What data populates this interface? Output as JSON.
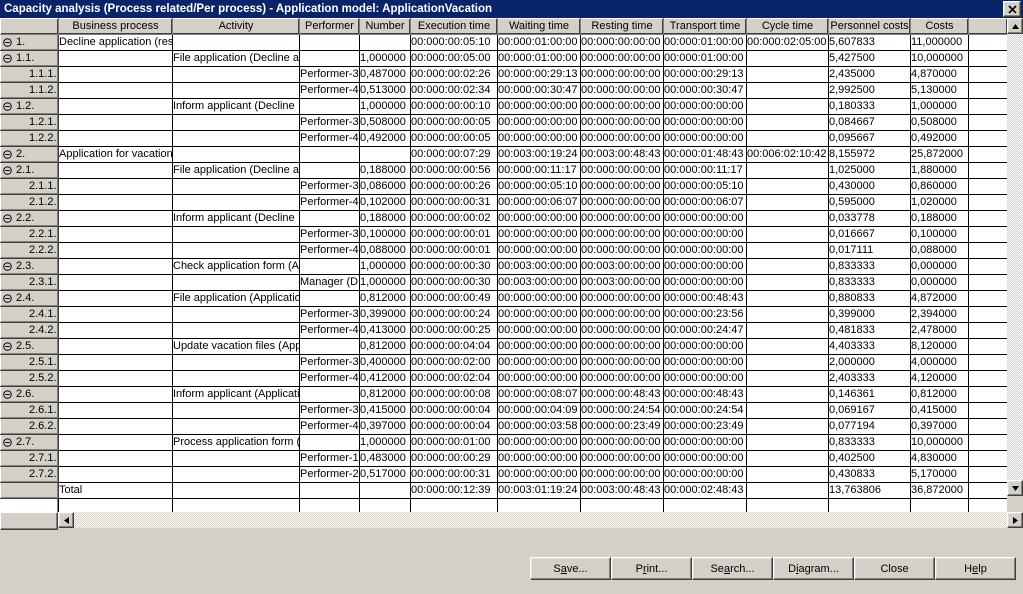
{
  "window": {
    "title": "Capacity analysis (Process related/Per process) - Application model: ApplicationVacation",
    "close_label": "✕"
  },
  "grid": {
    "columns": [
      {
        "key": "rowhdr",
        "label": ""
      },
      {
        "key": "business",
        "label": "Business process"
      },
      {
        "key": "activity",
        "label": "Activity"
      },
      {
        "key": "performer",
        "label": "Performer"
      },
      {
        "key": "number",
        "label": "Number"
      },
      {
        "key": "exec",
        "label": "Execution time"
      },
      {
        "key": "wait",
        "label": "Waiting time"
      },
      {
        "key": "rest",
        "label": "Resting time"
      },
      {
        "key": "transport",
        "label": "Transport time"
      },
      {
        "key": "cycle",
        "label": "Cycle time"
      },
      {
        "key": "personnel",
        "label": "Personnel costs"
      },
      {
        "key": "costs",
        "label": "Costs"
      },
      {
        "key": "pad",
        "label": ""
      }
    ],
    "rows": [
      {
        "num": "1.",
        "level": 0,
        "expander": "collapse",
        "business": "Decline application (res",
        "activity": "",
        "performer": "",
        "number": "",
        "exec": "00:000:00:05:10",
        "wait": "00:000:01:00:00",
        "rest": "00:000:00:00:00",
        "transport": "00:000:01:00:00",
        "cycle": "00:000:02:05:00",
        "personnel": "5,607833",
        "costs": "11,000000"
      },
      {
        "num": "1.1.",
        "level": 1,
        "expander": "collapse",
        "business": "",
        "activity": "File application (Decline a",
        "performer": "",
        "number": "1,000000",
        "exec": "00:000:00:05:00",
        "wait": "00:000:01:00:00",
        "rest": "00:000:00:00:00",
        "transport": "00:000:01:00:00",
        "cycle": "",
        "personnel": "5,427500",
        "costs": "10,000000"
      },
      {
        "num": "1.1.1.",
        "level": 2,
        "expander": "none",
        "business": "",
        "activity": "",
        "performer": "Performer-3",
        "number": "0,487000",
        "exec": "00:000:00:02:26",
        "wait": "00:000:00:29:13",
        "rest": "00:000:00:00:00",
        "transport": "00:000:00:29:13",
        "cycle": "",
        "personnel": "2,435000",
        "costs": "4,870000"
      },
      {
        "num": "1.1.2.",
        "level": 2,
        "expander": "none",
        "business": "",
        "activity": "",
        "performer": "Performer-4",
        "number": "0,513000",
        "exec": "00:000:00:02:34",
        "wait": "00:000:00:30:47",
        "rest": "00:000:00:00:00",
        "transport": "00:000:00:30:47",
        "cycle": "",
        "personnel": "2,992500",
        "costs": "5,130000"
      },
      {
        "num": "1.2.",
        "level": 1,
        "expander": "collapse",
        "business": "",
        "activity": "Inform applicant (Decline ",
        "performer": "",
        "number": "1,000000",
        "exec": "00:000:00:00:10",
        "wait": "00:000:00:00:00",
        "rest": "00:000:00:00:00",
        "transport": "00:000:00:00:00",
        "cycle": "",
        "personnel": "0,180333",
        "costs": "1,000000"
      },
      {
        "num": "1.2.1.",
        "level": 2,
        "expander": "none",
        "business": "",
        "activity": "",
        "performer": "Performer-3",
        "number": "0,508000",
        "exec": "00:000:00:00:05",
        "wait": "00:000:00:00:00",
        "rest": "00:000:00:00:00",
        "transport": "00:000:00:00:00",
        "cycle": "",
        "personnel": "0,084667",
        "costs": "0,508000"
      },
      {
        "num": "1.2.2.",
        "level": 2,
        "expander": "none",
        "business": "",
        "activity": "",
        "performer": "Performer-4",
        "number": "0,492000",
        "exec": "00:000:00:00:05",
        "wait": "00:000:00:00:00",
        "rest": "00:000:00:00:00",
        "transport": "00:000:00:00:00",
        "cycle": "",
        "personnel": "0,095667",
        "costs": "0,492000"
      },
      {
        "num": "2.",
        "level": 0,
        "expander": "collapse",
        "business": "Application for vacation",
        "activity": "",
        "performer": "",
        "number": "",
        "exec": "00:000:00:07:29",
        "wait": "00:003:00:19:24",
        "rest": "00:003:00:48:43",
        "transport": "00:000:01:48:43",
        "cycle": "00:006:02:10:42",
        "personnel": "8,155972",
        "costs": "25,872000"
      },
      {
        "num": "2.1.",
        "level": 1,
        "expander": "collapse",
        "business": "",
        "activity": "File application (Decline a",
        "performer": "",
        "number": "0,188000",
        "exec": "00:000:00:00:56",
        "wait": "00:000:00:11:17",
        "rest": "00:000:00:00:00",
        "transport": "00:000:00:11:17",
        "cycle": "",
        "personnel": "1,025000",
        "costs": "1,880000"
      },
      {
        "num": "2.1.1.",
        "level": 2,
        "expander": "none",
        "business": "",
        "activity": "",
        "performer": "Performer-3",
        "number": "0,086000",
        "exec": "00:000:00:00:26",
        "wait": "00:000:00:05:10",
        "rest": "00:000:00:00:00",
        "transport": "00:000:00:05:10",
        "cycle": "",
        "personnel": "0,430000",
        "costs": "0,860000"
      },
      {
        "num": "2.1.2.",
        "level": 2,
        "expander": "none",
        "business": "",
        "activity": "",
        "performer": "Performer-4",
        "number": "0,102000",
        "exec": "00:000:00:00:31",
        "wait": "00:000:00:06:07",
        "rest": "00:000:00:00:00",
        "transport": "00:000:00:06:07",
        "cycle": "",
        "personnel": "0,595000",
        "costs": "1,020000"
      },
      {
        "num": "2.2.",
        "level": 1,
        "expander": "collapse",
        "business": "",
        "activity": "Inform applicant (Decline ",
        "performer": "",
        "number": "0,188000",
        "exec": "00:000:00:00:02",
        "wait": "00:000:00:00:00",
        "rest": "00:000:00:00:00",
        "transport": "00:000:00:00:00",
        "cycle": "",
        "personnel": "0,033778",
        "costs": "0,188000"
      },
      {
        "num": "2.2.1.",
        "level": 2,
        "expander": "none",
        "business": "",
        "activity": "",
        "performer": "Performer-3",
        "number": "0,100000",
        "exec": "00:000:00:00:01",
        "wait": "00:000:00:00:00",
        "rest": "00:000:00:00:00",
        "transport": "00:000:00:00:00",
        "cycle": "",
        "personnel": "0,016667",
        "costs": "0,100000"
      },
      {
        "num": "2.2.2.",
        "level": 2,
        "expander": "none",
        "business": "",
        "activity": "",
        "performer": "Performer-4",
        "number": "0,088000",
        "exec": "00:000:00:00:01",
        "wait": "00:000:00:00:00",
        "rest": "00:000:00:00:00",
        "transport": "00:000:00:00:00",
        "cycle": "",
        "personnel": "0,017111",
        "costs": "0,088000"
      },
      {
        "num": "2.3.",
        "level": 1,
        "expander": "collapse",
        "business": "",
        "activity": "Check application form (A",
        "performer": "",
        "number": "1,000000",
        "exec": "00:000:00:00:30",
        "wait": "00:003:00:00:00",
        "rest": "00:003:00:00:00",
        "transport": "00:000:00:00:00",
        "cycle": "",
        "personnel": "0,833333",
        "costs": "0,000000"
      },
      {
        "num": "2.3.1.",
        "level": 2,
        "expander": "none",
        "business": "",
        "activity": "",
        "performer": "Manager (D",
        "number": "1,000000",
        "exec": "00:000:00:00:30",
        "wait": "00:003:00:00:00",
        "rest": "00:003:00:00:00",
        "transport": "00:000:00:00:00",
        "cycle": "",
        "personnel": "0,833333",
        "costs": "0,000000"
      },
      {
        "num": "2.4.",
        "level": 1,
        "expander": "collapse",
        "business": "",
        "activity": "File application (Applicatio",
        "performer": "",
        "number": "0,812000",
        "exec": "00:000:00:00:49",
        "wait": "00:000:00:00:00",
        "rest": "00:000:00:00:00",
        "transport": "00:000:00:48:43",
        "cycle": "",
        "personnel": "0,880833",
        "costs": "4,872000"
      },
      {
        "num": "2.4.1.",
        "level": 2,
        "expander": "none",
        "business": "",
        "activity": "",
        "performer": "Performer-3",
        "number": "0,399000",
        "exec": "00:000:00:00:24",
        "wait": "00:000:00:00:00",
        "rest": "00:000:00:00:00",
        "transport": "00:000:00:23:56",
        "cycle": "",
        "personnel": "0,399000",
        "costs": "2,394000"
      },
      {
        "num": "2.4.2.",
        "level": 2,
        "expander": "none",
        "business": "",
        "activity": "",
        "performer": "Performer-4",
        "number": "0,413000",
        "exec": "00:000:00:00:25",
        "wait": "00:000:00:00:00",
        "rest": "00:000:00:00:00",
        "transport": "00:000:00:24:47",
        "cycle": "",
        "personnel": "0,481833",
        "costs": "2,478000"
      },
      {
        "num": "2.5.",
        "level": 1,
        "expander": "collapse",
        "business": "",
        "activity": "Update vacation files (App",
        "performer": "",
        "number": "0,812000",
        "exec": "00:000:00:04:04",
        "wait": "00:000:00:00:00",
        "rest": "00:000:00:00:00",
        "transport": "00:000:00:00:00",
        "cycle": "",
        "personnel": "4,403333",
        "costs": "8,120000"
      },
      {
        "num": "2.5.1.",
        "level": 2,
        "expander": "none",
        "business": "",
        "activity": "",
        "performer": "Performer-3",
        "number": "0,400000",
        "exec": "00:000:00:02:00",
        "wait": "00:000:00:00:00",
        "rest": "00:000:00:00:00",
        "transport": "00:000:00:00:00",
        "cycle": "",
        "personnel": "2,000000",
        "costs": "4,000000"
      },
      {
        "num": "2.5.2.",
        "level": 2,
        "expander": "none",
        "business": "",
        "activity": "",
        "performer": "Performer-4",
        "number": "0,412000",
        "exec": "00:000:00:02:04",
        "wait": "00:000:00:00:00",
        "rest": "00:000:00:00:00",
        "transport": "00:000:00:00:00",
        "cycle": "",
        "personnel": "2,403333",
        "costs": "4,120000"
      },
      {
        "num": "2.6.",
        "level": 1,
        "expander": "collapse",
        "business": "",
        "activity": "Inform applicant (Applicati",
        "performer": "",
        "number": "0,812000",
        "exec": "00:000:00:00:08",
        "wait": "00:000:00:08:07",
        "rest": "00:000:00:48:43",
        "transport": "00:000:00:48:43",
        "cycle": "",
        "personnel": "0,146361",
        "costs": "0,812000"
      },
      {
        "num": "2.6.1.",
        "level": 2,
        "expander": "none",
        "business": "",
        "activity": "",
        "performer": "Performer-3",
        "number": "0,415000",
        "exec": "00:000:00:00:04",
        "wait": "00:000:00:04:09",
        "rest": "00:000:00:24:54",
        "transport": "00:000:00:24:54",
        "cycle": "",
        "personnel": "0,069167",
        "costs": "0,415000"
      },
      {
        "num": "2.6.2.",
        "level": 2,
        "expander": "none",
        "business": "",
        "activity": "",
        "performer": "Performer-4",
        "number": "0,397000",
        "exec": "00:000:00:00:04",
        "wait": "00:000:00:03:58",
        "rest": "00:000:00:23:49",
        "transport": "00:000:00:23:49",
        "cycle": "",
        "personnel": "0,077194",
        "costs": "0,397000"
      },
      {
        "num": "2.7.",
        "level": 1,
        "expander": "collapse",
        "business": "",
        "activity": "Process application form (",
        "performer": "",
        "number": "1,000000",
        "exec": "00:000:00:01:00",
        "wait": "00:000:00:00:00",
        "rest": "00:000:00:00:00",
        "transport": "00:000:00:00:00",
        "cycle": "",
        "personnel": "0,833333",
        "costs": "10,000000"
      },
      {
        "num": "2.7.1.",
        "level": 2,
        "expander": "none",
        "business": "",
        "activity": "",
        "performer": "Performer-1",
        "number": "0,483000",
        "exec": "00:000:00:00:29",
        "wait": "00:000:00:00:00",
        "rest": "00:000:00:00:00",
        "transport": "00:000:00:00:00",
        "cycle": "",
        "personnel": "0,402500",
        "costs": "4,830000"
      },
      {
        "num": "2.7.2.",
        "level": 2,
        "expander": "none",
        "business": "",
        "activity": "",
        "performer": "Performer-2",
        "number": "0,517000",
        "exec": "00:000:00:00:31",
        "wait": "00:000:00:00:00",
        "rest": "00:000:00:00:00",
        "transport": "00:000:00:00:00",
        "cycle": "",
        "personnel": "0,430833",
        "costs": "5,170000"
      },
      {
        "num": "",
        "level": 0,
        "expander": "none",
        "business": "Total",
        "activity": "",
        "performer": "",
        "number": "",
        "exec": "00:000:00:12:39",
        "wait": "00:003:01:19:24",
        "rest": "00:003:00:48:43",
        "transport": "00:000:02:48:43",
        "cycle": "",
        "personnel": "13,763806",
        "costs": "36,872000"
      }
    ]
  },
  "scrollbars": {
    "v_up": "▲",
    "v_down": "▼",
    "h_left": "◄",
    "h_right": "►"
  },
  "buttons": [
    {
      "name": "save",
      "pre": "S",
      "accel": "a",
      "post": "ve..."
    },
    {
      "name": "print",
      "pre": "P",
      "accel": "r",
      "post": "int..."
    },
    {
      "name": "search",
      "pre": "Se",
      "accel": "a",
      "post": "rch..."
    },
    {
      "name": "diagram",
      "pre": "D",
      "accel": "i",
      "post": "agram..."
    },
    {
      "name": "close",
      "pre": "Close",
      "accel": "",
      "post": ""
    },
    {
      "name": "help",
      "pre": "H",
      "accel": "e",
      "post": "lp"
    }
  ],
  "theme": {
    "titlebar_bg": "#0a246a",
    "face": "#d4d0c8",
    "grid_bg": "#ffffff",
    "grid_line": "#000000"
  }
}
